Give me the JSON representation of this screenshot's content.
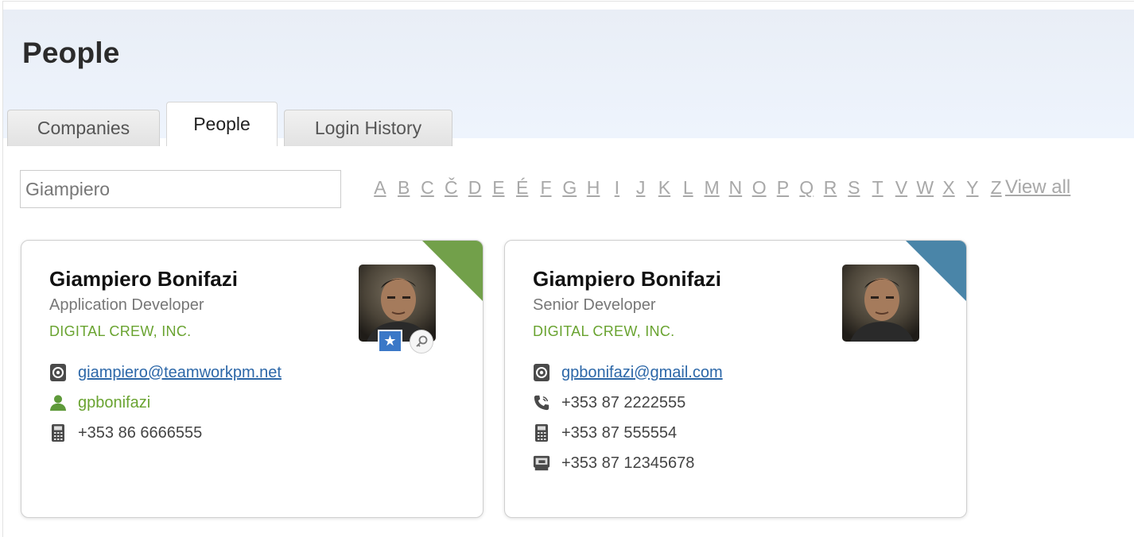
{
  "header": {
    "title": "People"
  },
  "tabs": [
    {
      "label": "Companies"
    },
    {
      "label": "People"
    },
    {
      "label": "Login History"
    }
  ],
  "search": {
    "value": "Giampiero"
  },
  "alphabet": [
    "A",
    "B",
    "C",
    "Č",
    "D",
    "E",
    "É",
    "F",
    "G",
    "H",
    "I",
    "J",
    "K",
    "L",
    "M",
    "N",
    "O",
    "P",
    "Q",
    "R",
    "S",
    "T",
    "V",
    "W",
    "X",
    "Y",
    "Z"
  ],
  "view_all_label": "View all",
  "cards": [
    {
      "name": "Giampiero Bonifazi",
      "title": "Application Developer",
      "company": "DIGITAL CREW, INC.",
      "corner_color": "#72a04a",
      "email": "giampiero@teamworkpm.net",
      "username": "gpbonifazi",
      "mobile": "+353 86 6666555"
    },
    {
      "name": "Giampiero Bonifazi",
      "title": "Senior Developer",
      "company": "DIGITAL CREW, INC.",
      "corner_color": "#4a85a8",
      "email": "gpbonifazi@gmail.com",
      "phone": "+353 87 2222555",
      "mobile": "+353 87 555554",
      "fax": "+353 87 12345678"
    }
  ],
  "icons": {
    "email": "at-sign-icon",
    "user": "user-icon",
    "mobile": "mobile-phone-icon",
    "phone": "phone-icon",
    "fax": "fax-icon",
    "star": "star-icon",
    "key": "key-icon"
  }
}
